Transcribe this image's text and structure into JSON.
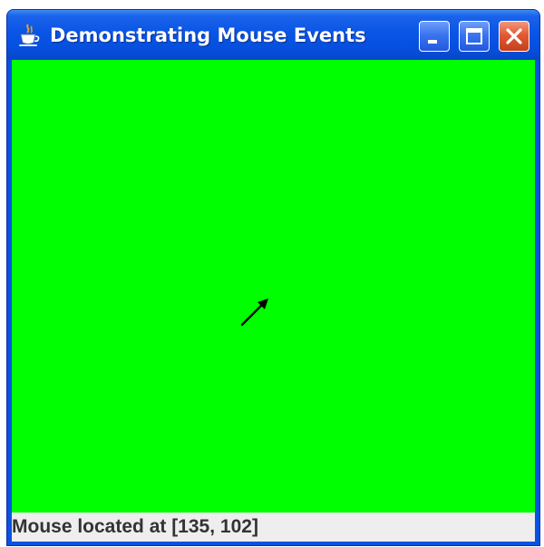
{
  "window": {
    "title": "Demonstrating Mouse Events",
    "icon": "java-cup-icon",
    "controls": {
      "minimize": "minimize-icon",
      "maximize": "maximize-icon",
      "close": "close-icon"
    }
  },
  "content": {
    "background_color": "#00ff00",
    "cursor": "arrow-cursor-icon"
  },
  "statusbar": {
    "text": "Mouse located at [135, 102]"
  },
  "colors": {
    "titlebar": "#0a55e6",
    "close_button": "#e35a32",
    "panel": "#00ff00",
    "status_background": "#eeeeee"
  }
}
